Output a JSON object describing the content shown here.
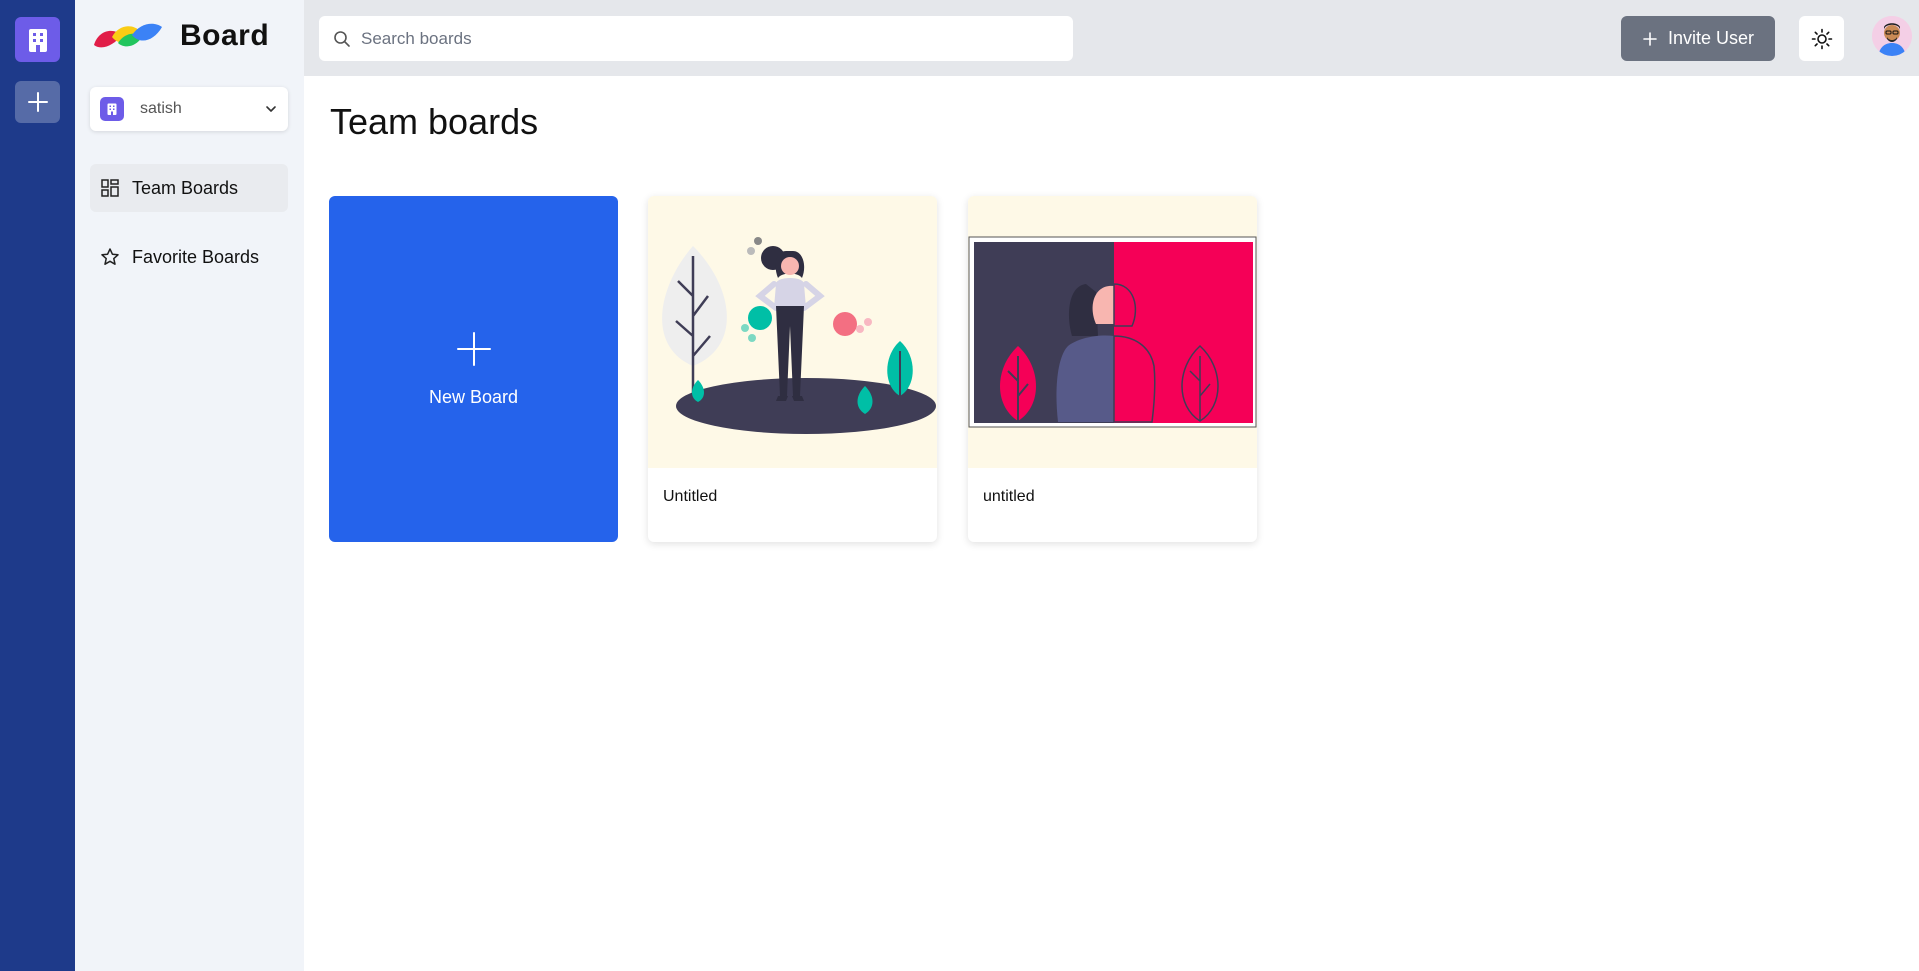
{
  "brand": {
    "name": "Board"
  },
  "organization": {
    "name": "satish"
  },
  "sidebar": {
    "items": [
      {
        "label": "Team Boards",
        "icon": "dashboard-icon",
        "active": true
      },
      {
        "label": "Favorite Boards",
        "icon": "star-icon",
        "active": false
      }
    ]
  },
  "search": {
    "placeholder": "Search boards",
    "value": ""
  },
  "header": {
    "invite_label": "Invite User"
  },
  "main": {
    "title": "Team boards",
    "new_board_label": "New Board",
    "boards": [
      {
        "title": "Untitled"
      },
      {
        "title": "untitled"
      }
    ]
  },
  "colors": {
    "rail": "#1e3a8a",
    "accent": "#2563eb",
    "org_avatar": "#6d5ce8",
    "invite_button": "#6b7280"
  }
}
